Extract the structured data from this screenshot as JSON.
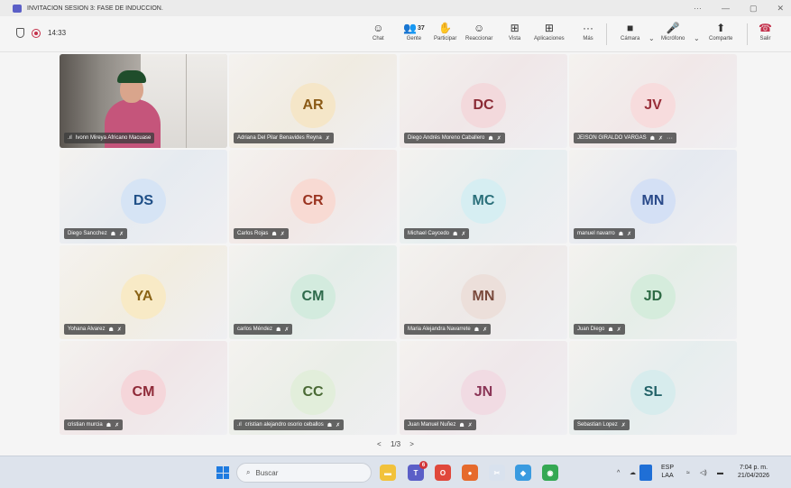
{
  "window": {
    "title": "INVITACION SESION 3: FASE DE INDUCCION.",
    "controls": [
      "···",
      "—",
      "▢",
      "✕"
    ]
  },
  "toolbar": {
    "timer": "14:33",
    "buttons": [
      {
        "id": "chat",
        "label": "Chat",
        "icon": "chat-icon",
        "glyph": "☺"
      },
      {
        "id": "people",
        "label": "Gente",
        "icon": "people-icon",
        "glyph": "👥",
        "count": "37"
      },
      {
        "id": "raise",
        "label": "Participar",
        "icon": "raise-hand-icon",
        "glyph": "✋"
      },
      {
        "id": "react",
        "label": "Reaccionar",
        "icon": "smiley-icon",
        "glyph": "☺"
      },
      {
        "id": "view",
        "label": "Vista",
        "icon": "grid-icon",
        "glyph": "⊞"
      },
      {
        "id": "apps",
        "label": "Aplicaciones",
        "icon": "plus-square-icon",
        "glyph": "⊞"
      },
      {
        "id": "more",
        "label": "Más",
        "icon": "more-icon",
        "glyph": "···"
      },
      {
        "id": "camera",
        "label": "Cámara",
        "icon": "camera-icon",
        "glyph": "■"
      },
      {
        "id": "mic",
        "label": "Micrófono",
        "icon": "microphone-icon",
        "glyph": "🎤"
      },
      {
        "id": "share",
        "label": "Comparte",
        "icon": "share-icon",
        "glyph": "⬆"
      }
    ],
    "leave": {
      "label": "Salir",
      "icon": "phone-hangup-icon",
      "glyph": "☎"
    }
  },
  "participants": [
    {
      "name": "Ivonn Mireya Africano Macuase",
      "video": true,
      "signal": true
    },
    {
      "name": "Adriana Del Pilar Benavides Reyna",
      "initials": "AR",
      "bg": "#f5e6c8",
      "fg": "#8a5a16",
      "hand": false
    },
    {
      "name": "Diego Andrés Moreno Caballero",
      "initials": "DC",
      "bg": "#f3d9dc",
      "fg": "#8b2a35",
      "hand": true
    },
    {
      "name": "JEISON GIRALDO VARGAS",
      "initials": "JV",
      "bg": "#f7dcdd",
      "fg": "#9a2f3a",
      "hand": true,
      "more": "···"
    },
    {
      "name": "Diego Sancchez",
      "initials": "DS",
      "bg": "#d6e4f5",
      "fg": "#1f4f87",
      "hand": true
    },
    {
      "name": "Carlos Rojas",
      "initials": "CR",
      "bg": "#f8dad3",
      "fg": "#9a3320",
      "hand": true
    },
    {
      "name": "Michael Caycedo",
      "initials": "MC",
      "bg": "#d6eef2",
      "fg": "#2a6f7a",
      "hand": true
    },
    {
      "name": "manuel navarro",
      "initials": "MN",
      "bg": "#d4e0f5",
      "fg": "#2a4a8a",
      "hand": true
    },
    {
      "name": "Yohana Alvarez",
      "initials": "YA",
      "bg": "#f8eac6",
      "fg": "#8a6315",
      "hand": true
    },
    {
      "name": "carlos Méndez",
      "initials": "CM",
      "bg": "#d3ebde",
      "fg": "#2f6b4c",
      "hand": true
    },
    {
      "name": "Maria Alejandra Navarrete",
      "initials": "MN",
      "bg": "#ecdfda",
      "fg": "#7a4a3c",
      "hand": true
    },
    {
      "name": "Juan Diego",
      "initials": "JD",
      "bg": "#d5ecdc",
      "fg": "#2d6a44",
      "hand": true
    },
    {
      "name": "cristian murcia",
      "initials": "CM",
      "bg": "#f5d6da",
      "fg": "#8f2a38",
      "hand": true
    },
    {
      "name": "cristian alejandro osorio ceballos",
      "initials": "CC",
      "bg": "#e2eedb",
      "fg": "#4a6a35",
      "hand": true,
      "signal": true
    },
    {
      "name": "Juan Manuel Nuñez",
      "initials": "JN",
      "bg": "#f1dbe3",
      "fg": "#8a3355",
      "hand": true
    },
    {
      "name": "Sebastian Lopez",
      "initials": "SL",
      "bg": "#d7eced",
      "fg": "#226268",
      "hand": false
    }
  ],
  "pager": {
    "prev": "<",
    "label": "1/3",
    "next": ">"
  },
  "taskbar": {
    "search_placeholder": "Buscar",
    "apps": [
      {
        "icon": "file-explorer-icon",
        "color": "#f2c23b",
        "glyph": "▬"
      },
      {
        "icon": "teams-icon",
        "color": "#5b5fc7",
        "glyph": "T",
        "badge": "6"
      },
      {
        "icon": "opera-icon",
        "color": "#e0483b",
        "glyph": "O"
      },
      {
        "icon": "firefox-icon",
        "color": "#e66a2c",
        "glyph": "●"
      },
      {
        "icon": "snipping-tool-icon",
        "color": "#d9e2ee",
        "glyph": "✂"
      },
      {
        "icon": "copilot-icon",
        "color": "#3a9be0",
        "glyph": "◆"
      },
      {
        "icon": "chrome-icon",
        "color": "#34a853",
        "glyph": "◉"
      }
    ],
    "language": "ESP",
    "layout": "LAA",
    "time": "7:04 p. m.",
    "date": "21/04/2026"
  }
}
